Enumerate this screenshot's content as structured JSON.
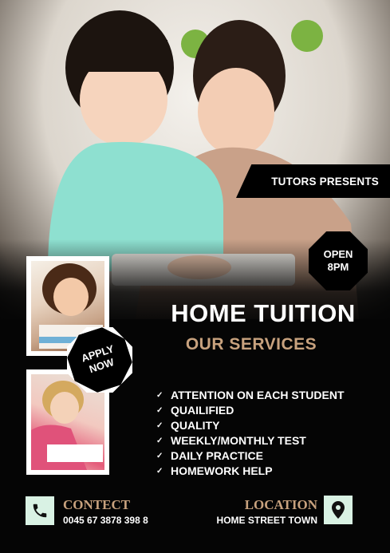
{
  "hero": {
    "banner": "TUTORS PRESENTS",
    "badge_line1": "OPEN",
    "badge_line2": "8PM"
  },
  "badge": {
    "line1": "APPLY",
    "line2": "NOW"
  },
  "heading": {
    "title": "HOME TUITION",
    "subtitle": "OUR SERVICES"
  },
  "services": [
    "ATTENTION ON EACH STUDENT",
    "QUAILIFIED",
    "QUALITY",
    "WEEKLY/MONTHLY TEST",
    "DAILY PRACTICE",
    "HOMEWORK HELP"
  ],
  "contact": {
    "label": "CONTECT",
    "value": "0045 67 3878 398 8",
    "icon": "phone-icon"
  },
  "location": {
    "label": "LOCATION",
    "value": "HOME STREET TOWN",
    "icon": "map-pin-icon"
  },
  "colors": {
    "background": "#050505",
    "accent": "#c8a27e",
    "icon_box": "#d9f2e4",
    "text": "#ffffff"
  }
}
